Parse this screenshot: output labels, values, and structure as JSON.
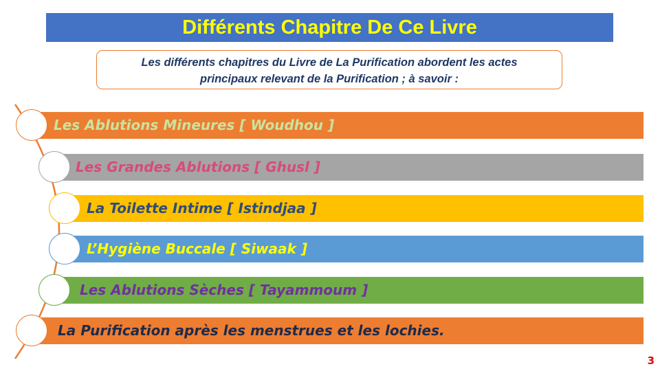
{
  "title": "Différents Chapitre De Ce Livre",
  "intro": {
    "line1": "Les différents chapitres du Livre de La Purification abordent les actes",
    "line2": "principaux relevant de la Purification ; à savoir  :"
  },
  "chapters": [
    {
      "label": "Les Ablutions Mineures [ Woudhou ]",
      "bar_color": "#ed7d31",
      "text_color": "#c9e3a0",
      "circle_color": "#ed7d31"
    },
    {
      "label": "Les Grandes Ablutions [ Ghusl ]",
      "bar_color": "#a5a5a5",
      "text_color": "#d64b7c",
      "circle_color": "#a5a5a5"
    },
    {
      "label": "La Toilette Intime [ Istindjaa ]",
      "bar_color": "#ffc000",
      "text_color": "#2f4d7a",
      "circle_color": "#ffc000"
    },
    {
      "label": "L’Hygiène Buccale [ Siwaak ]",
      "bar_color": "#5b9bd5",
      "text_color": "#ffff00",
      "circle_color": "#5b9bd5"
    },
    {
      "label": "Les Ablutions Sèches [ Tayammoum ]",
      "bar_color": "#70ad47",
      "text_color": "#7030a0",
      "circle_color": "#70ad47"
    },
    {
      "label": "La Purification après les menstrues et les lochies.",
      "bar_color": "#ed7d31",
      "text_color": "#1f2a4a",
      "circle_color": "#ed7d31"
    }
  ],
  "page_number": "3"
}
